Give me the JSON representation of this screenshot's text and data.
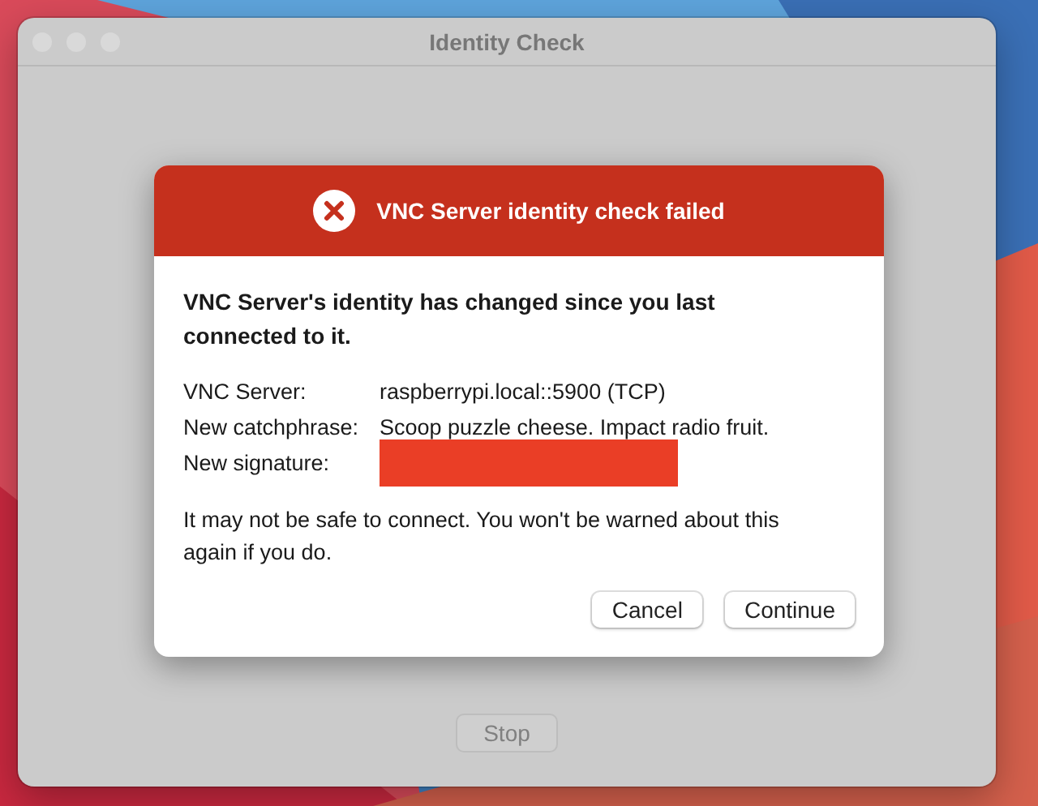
{
  "window": {
    "title": "Identity Check"
  },
  "dialog": {
    "title": "VNC Server identity check failed",
    "heading": "VNC Server's identity has changed since you last connected to it.",
    "details": [
      {
        "label": "VNC Server:",
        "value": "raspberrypi.local::5900 (TCP)",
        "kind": "text"
      },
      {
        "label": "New catchphrase:",
        "value": "Scoop puzzle cheese. Impact radio fruit.",
        "kind": "text"
      },
      {
        "label": "New signature:",
        "kind": "redacted"
      }
    ],
    "message": "It may not be safe to connect. You won't be warned about this again if you do.",
    "buttons": [
      "Cancel",
      "Continue"
    ]
  },
  "stop_button": {
    "label": "Stop",
    "disabled": true
  }
}
